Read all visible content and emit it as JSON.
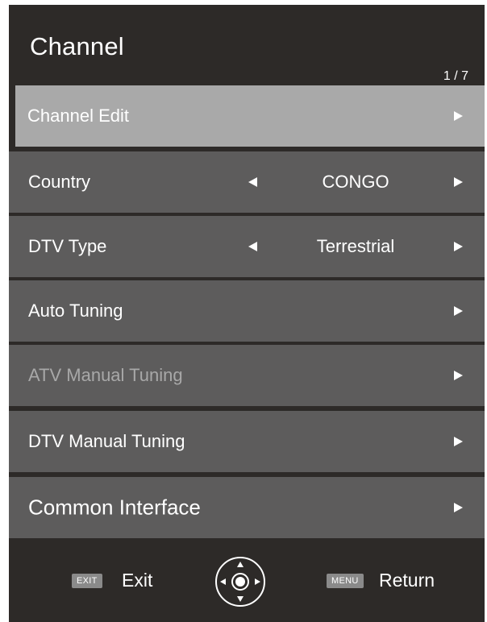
{
  "menu": {
    "title": "Channel",
    "page_indicator": "1 / 7",
    "items": [
      {
        "label": "Channel Edit",
        "selected": true
      },
      {
        "label": "Country",
        "value": "CONGO"
      },
      {
        "label": "DTV Type",
        "value": "Terrestrial"
      },
      {
        "label": "Auto Tuning"
      },
      {
        "label": "ATV Manual Tuning",
        "disabled": true
      },
      {
        "label": "DTV Manual Tuning"
      },
      {
        "label": "Common Interface"
      }
    ]
  },
  "footer": {
    "exit_key": "EXIT",
    "exit_label": "Exit",
    "menu_key": "MENU",
    "return_label": "Return"
  },
  "icons": {
    "arrow_right": "arrow-right-icon",
    "arrow_left": "arrow-left-icon",
    "nav_pad": "navigation-pad-icon"
  },
  "colors": {
    "background": "#2d2a28",
    "item": "#5d5c5c",
    "selected_item": "#a9a9a9",
    "disabled_text": "#a8a8a8",
    "text": "#ffffff"
  }
}
